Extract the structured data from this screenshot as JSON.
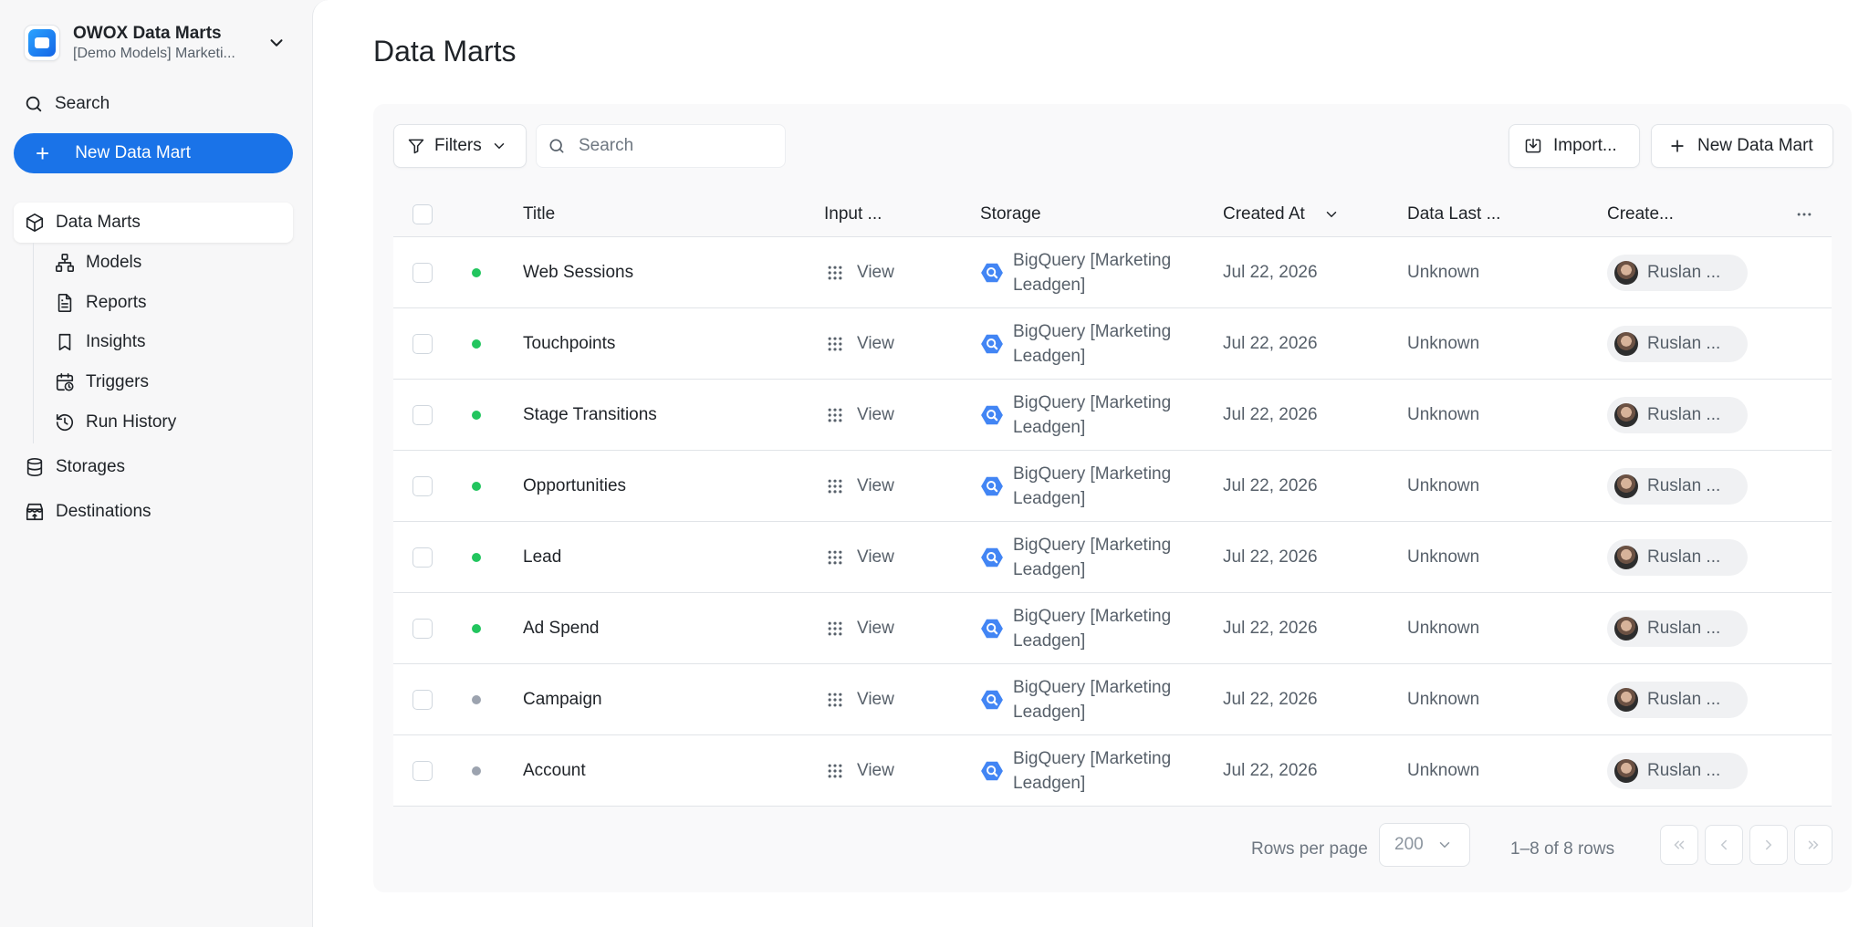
{
  "workspace": {
    "title": "OWOX Data Marts",
    "subtitle": "[Demo Models] Marketi..."
  },
  "sidebar": {
    "search_label": "Search",
    "new_button_label": "New Data Mart",
    "items": [
      {
        "label": "Data Marts",
        "icon": "cube-icon",
        "active": true
      },
      {
        "label": "Storages",
        "icon": "database-icon"
      },
      {
        "label": "Destinations",
        "icon": "destination-icon"
      }
    ],
    "sub_items": [
      {
        "label": "Models",
        "icon": "hierarchy-icon"
      },
      {
        "label": "Reports",
        "icon": "document-icon"
      },
      {
        "label": "Insights",
        "icon": "bookmark-icon"
      },
      {
        "label": "Triggers",
        "icon": "calendar-clock-icon"
      },
      {
        "label": "Run History",
        "icon": "history-icon"
      }
    ]
  },
  "page": {
    "title": "Data Marts"
  },
  "toolbar": {
    "filters_label": "Filters",
    "search_placeholder": "Search",
    "import_label": "Import...",
    "new_label": "New Data Mart"
  },
  "table": {
    "columns": [
      "Title",
      "Input ...",
      "Storage",
      "Created At",
      "Data Last ...",
      "Create..."
    ],
    "rows": [
      {
        "title": "Web Sessions",
        "status": "active",
        "input": "View",
        "storage": "BigQuery [Marketing Leadgen]",
        "created_at": "Jul 22, 2026",
        "data_last": "Unknown",
        "creator": "Ruslan ..."
      },
      {
        "title": "Touchpoints",
        "status": "active",
        "input": "View",
        "storage": "BigQuery [Marketing Leadgen]",
        "created_at": "Jul 22, 2026",
        "data_last": "Unknown",
        "creator": "Ruslan ..."
      },
      {
        "title": "Stage Transitions",
        "status": "active",
        "input": "View",
        "storage": "BigQuery [Marketing Leadgen]",
        "created_at": "Jul 22, 2026",
        "data_last": "Unknown",
        "creator": "Ruslan ..."
      },
      {
        "title": "Opportunities",
        "status": "active",
        "input": "View",
        "storage": "BigQuery [Marketing Leadgen]",
        "created_at": "Jul 22, 2026",
        "data_last": "Unknown",
        "creator": "Ruslan ..."
      },
      {
        "title": "Lead",
        "status": "active",
        "input": "View",
        "storage": "BigQuery [Marketing Leadgen]",
        "created_at": "Jul 22, 2026",
        "data_last": "Unknown",
        "creator": "Ruslan ..."
      },
      {
        "title": "Ad Spend",
        "status": "active",
        "input": "View",
        "storage": "BigQuery [Marketing Leadgen]",
        "created_at": "Jul 22, 2026",
        "data_last": "Unknown",
        "creator": "Ruslan ..."
      },
      {
        "title": "Campaign",
        "status": "inactive",
        "input": "View",
        "storage": "BigQuery [Marketing Leadgen]",
        "created_at": "Jul 22, 2026",
        "data_last": "Unknown",
        "creator": "Ruslan ..."
      },
      {
        "title": "Account",
        "status": "inactive",
        "input": "View",
        "storage": "BigQuery [Marketing Leadgen]",
        "created_at": "Jul 22, 2026",
        "data_last": "Unknown",
        "creator": "Ruslan ..."
      }
    ]
  },
  "pagination": {
    "rows_per_page_label": "Rows per page",
    "rows_per_page_value": "200",
    "range_text": "1–8 of 8 rows"
  },
  "colors": {
    "accent": "#1a73e8",
    "status_active": "#22c55e",
    "status_inactive": "#9ca3af",
    "bigquery": "#4285f4"
  }
}
